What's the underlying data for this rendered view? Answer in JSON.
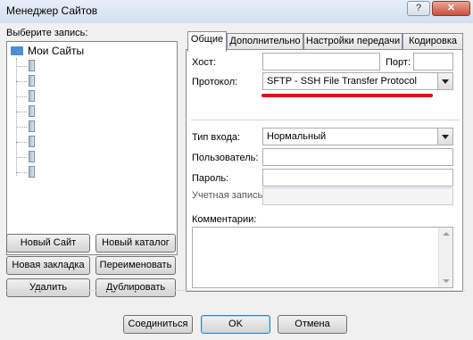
{
  "window": {
    "title": "Менеджер Сайтов",
    "help_glyph": "?",
    "close_glyph": "✕"
  },
  "left": {
    "select_label": "Выберите запись:",
    "tree": {
      "root_label": "Мои Сайты",
      "items": [
        "",
        "",
        "",
        "",
        "",
        "",
        "",
        ""
      ]
    },
    "buttons": {
      "new_site": "Новый Сайт",
      "new_folder": "Новый каталог",
      "new_bookmark": "Новая закладка",
      "rename": "Переименовать",
      "delete": "Удалить",
      "duplicate": "Дублировать"
    }
  },
  "tabs": [
    "Общие",
    "Дополнительно",
    "Настройки передачи",
    "Кодировка"
  ],
  "general": {
    "host_label": "Хост:",
    "host_value": "",
    "port_label": "Порт:",
    "port_value": "",
    "protocol_label": "Протокол:",
    "protocol_value": "SFTP - SSH File Transfer Protocol",
    "logon_label": "Тип входа:",
    "logon_value": "Нормальный",
    "user_label": "Пользователь:",
    "user_value": "",
    "password_label": "Пароль:",
    "password_value": "",
    "account_label": "Учетная запись:",
    "comments_label": "Комментарии:"
  },
  "footer": {
    "connect": "Соединиться",
    "ok": "OK",
    "cancel": "Отмена"
  },
  "colors": {
    "highlight_underline": "#e0101c",
    "window_frame": "#d9e4f1"
  }
}
